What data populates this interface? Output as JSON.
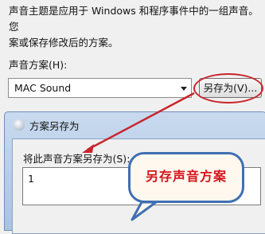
{
  "description": "声音主题是应用于 Windows 和程序事件中的一组声音。您\n案或保存修改后的方案。",
  "scheme": {
    "label": "声音方案(H):",
    "selected": "MAC Sound",
    "save_as_button": "另存为(V)..."
  },
  "save_dialog": {
    "title": "方案另存为",
    "name_label": "将此声音方案另存为(S):",
    "name_value": "1"
  },
  "annotation": {
    "callout_text": "另存声音方案",
    "colors": {
      "ring": "#c8252b",
      "arrow": "#c8252b",
      "callout_border": "#3f6fb3",
      "callout_text": "#d4141c"
    }
  }
}
